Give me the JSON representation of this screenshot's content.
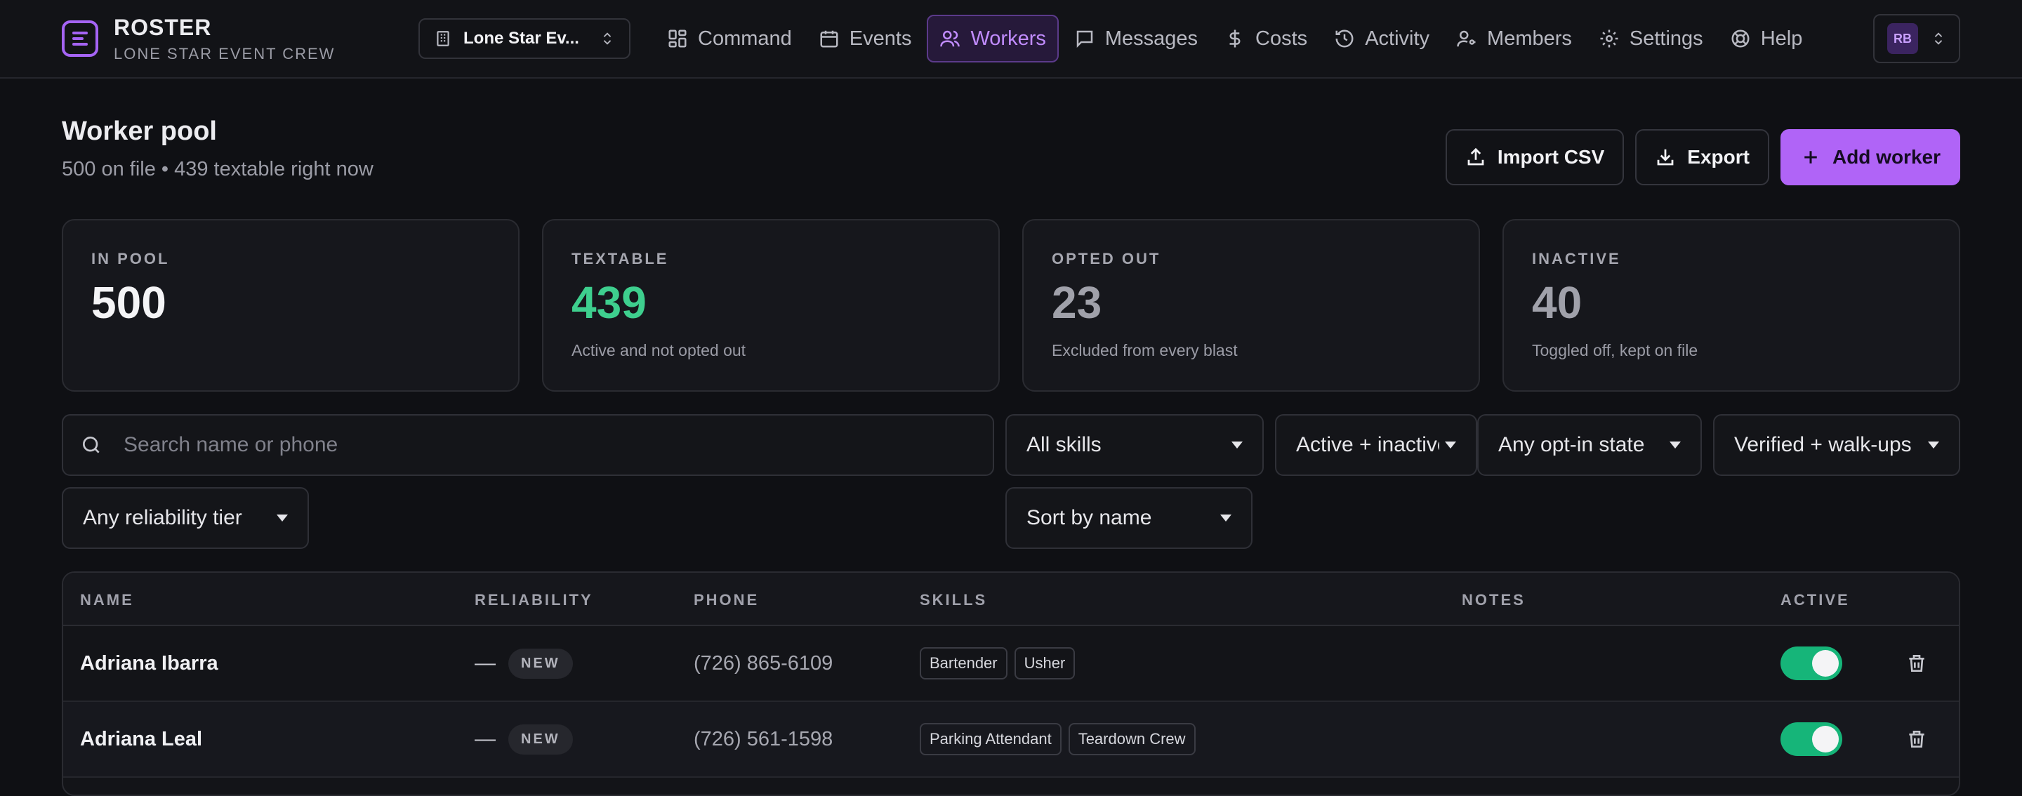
{
  "app": {
    "title": "ROSTER",
    "subtitle": "LONE STAR EVENT CREW",
    "event_selector": "Lone Star Ev..."
  },
  "nav": [
    {
      "label": "Command",
      "icon": "layout-grid-icon"
    },
    {
      "label": "Events",
      "icon": "calendar-icon"
    },
    {
      "label": "Workers",
      "icon": "users-icon",
      "active": true
    },
    {
      "label": "Messages",
      "icon": "message-icon"
    },
    {
      "label": "Costs",
      "icon": "dollar-icon"
    },
    {
      "label": "Activity",
      "icon": "history-icon"
    },
    {
      "label": "Members",
      "icon": "user-key-icon"
    },
    {
      "label": "Settings",
      "icon": "gear-icon"
    },
    {
      "label": "Help",
      "icon": "lifebuoy-icon"
    }
  ],
  "account": {
    "initials": "RB"
  },
  "page": {
    "title": "Worker pool",
    "subtitle": "500 on file • 439 textable right now"
  },
  "actions": {
    "import": "Import CSV",
    "export": "Export",
    "add": "Add worker"
  },
  "stats": [
    {
      "label": "IN POOL",
      "value": "500",
      "note": "",
      "color": "#f4f4f6"
    },
    {
      "label": "TEXTABLE",
      "value": "439",
      "note": "Active and not opted out",
      "color": "#3ecf8e"
    },
    {
      "label": "OPTED OUT",
      "value": "23",
      "note": "Excluded from every blast",
      "color": "#a0a1aa"
    },
    {
      "label": "INACTIVE",
      "value": "40",
      "note": "Toggled off, kept on file",
      "color": "#a0a1aa"
    }
  ],
  "filters": {
    "search_placeholder": "Search name or phone",
    "skills": "All skills",
    "status": "Active + inactive",
    "opt_in": "Any opt-in state",
    "verified": "Verified + walk-ups",
    "reliability": "Any reliability tier",
    "sort": "Sort by name"
  },
  "table": {
    "columns": [
      "NAME",
      "RELIABILITY",
      "PHONE",
      "SKILLS",
      "NOTES",
      "ACTIVE"
    ],
    "rows": [
      {
        "name": "Adriana Ibarra",
        "reliability": "—",
        "tier": "NEW",
        "phone": "(726) 865-6109",
        "skills": [
          "Bartender",
          "Usher"
        ],
        "notes": "",
        "active": true
      },
      {
        "name": "Adriana Leal",
        "reliability": "—",
        "tier": "NEW",
        "phone": "(726) 561-1598",
        "skills": [
          "Parking Attendant",
          "Teardown Crew"
        ],
        "notes": "",
        "active": true
      }
    ]
  },
  "colors": {
    "accent": "#b064f7",
    "success": "#16b579"
  }
}
